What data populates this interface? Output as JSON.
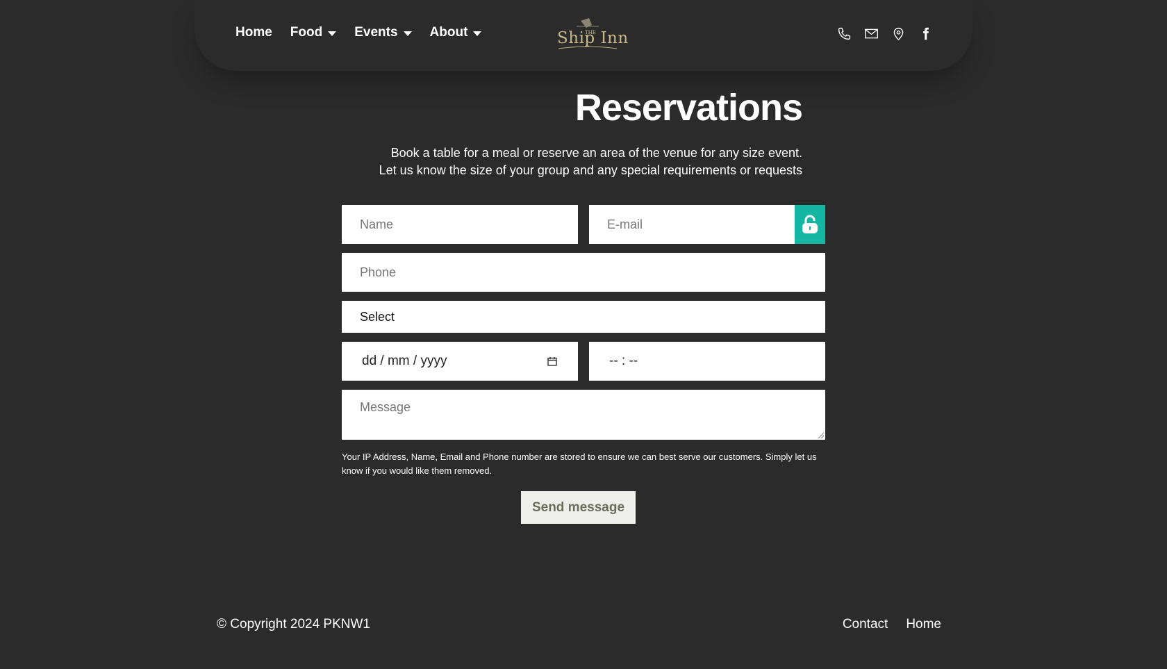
{
  "nav": {
    "items": [
      {
        "label": "Home",
        "dropdown": false
      },
      {
        "label": "Food",
        "dropdown": true
      },
      {
        "label": "Events",
        "dropdown": true
      },
      {
        "label": "About",
        "dropdown": true
      }
    ]
  },
  "logo": {
    "the": "THE",
    "text": "Ship Inn"
  },
  "header_icons": [
    "phone-icon",
    "mail-icon",
    "map-pin-icon",
    "facebook-icon"
  ],
  "page": {
    "title": "Reservations",
    "intro_line1": "Book a table for a meal or reserve an area of the venue for any size event.",
    "intro_line2": "Let us know the size of your group and any special requirements or requests"
  },
  "form": {
    "name_placeholder": "Name",
    "email_placeholder": "E-mail",
    "phone_placeholder": "Phone",
    "select_value": "Select",
    "date_placeholder": "dd / mm / yyyy",
    "time_placeholder": "-- : --",
    "message_placeholder": "Message",
    "privacy_note": "Your IP Address, Name, Email and Phone number are stored to ensure we can best serve our customers. Simply let us know if you would like them removed.",
    "send_label": "Send message"
  },
  "colors": {
    "background": "#2b2b2b",
    "accent": "#15b7a4",
    "logo": "#c8b98a"
  },
  "footer": {
    "copyright": "© Copyright 2024 PKNW1",
    "links": [
      "Contact",
      "Home"
    ]
  }
}
